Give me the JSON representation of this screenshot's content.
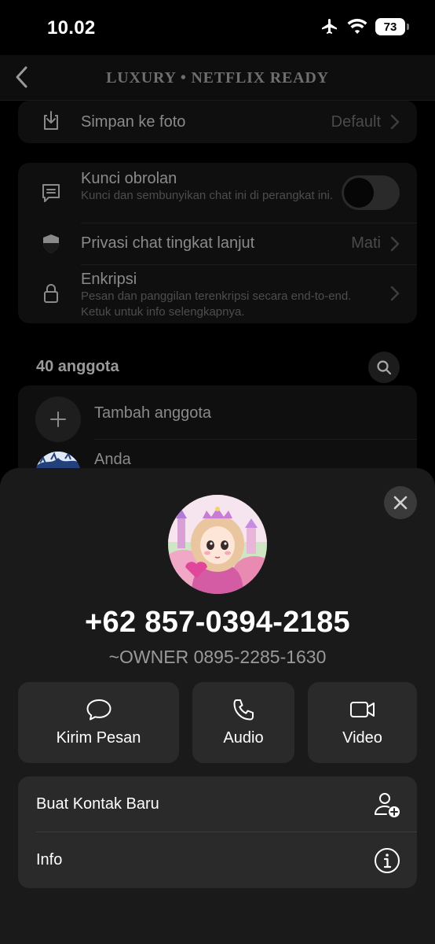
{
  "status_bar": {
    "time": "10.02",
    "battery": "73"
  },
  "nav": {
    "title": "LUXURY • NETFLIX READY"
  },
  "settings": {
    "save_photo": {
      "label": "Simpan ke foto",
      "value": "Default"
    },
    "chat_lock": {
      "label": "Kunci obrolan",
      "description": "Kunci dan sembunyikan chat ini di perangkat ini.",
      "enabled": false
    },
    "advanced_privacy": {
      "label": "Privasi chat tingkat lanjut",
      "value": "Mati"
    },
    "encryption": {
      "label": "Enkripsi",
      "description": "Pesan dan panggilan terenkripsi secara end-to-end. Ketuk untuk info selengkapnya."
    }
  },
  "members": {
    "count_label": "40 anggota",
    "add_label": "Tambah anggota",
    "first_member": "Anda"
  },
  "contact_sheet": {
    "phone": "+62 857-0394-2185",
    "subname": "~OWNER 0895-2285-1630",
    "actions": [
      {
        "label": "Kirim Pesan",
        "icon": "message-bubble-icon"
      },
      {
        "label": "Audio",
        "icon": "phone-icon"
      },
      {
        "label": "Video",
        "icon": "video-camera-icon"
      }
    ],
    "rows": [
      {
        "label": "Buat Kontak Baru",
        "icon": "add-contact-icon"
      },
      {
        "label": "Info",
        "icon": "info-icon"
      }
    ]
  },
  "colors": {
    "sheet_bg": "#1a1a1a",
    "button_bg": "#2a2a2a",
    "text_primary": "#ffffff",
    "text_secondary": "#9a9a9a"
  }
}
